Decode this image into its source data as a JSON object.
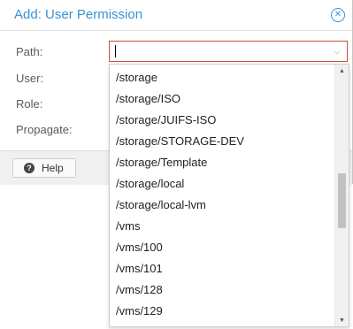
{
  "dialog": {
    "title": "Add: User Permission",
    "close_icon": "close-circle-icon"
  },
  "form": {
    "path_label": "Path:",
    "user_label": "User:",
    "role_label": "Role:",
    "propagate_label": "Propagate:",
    "path_value": ""
  },
  "footer": {
    "help_label": "Help",
    "help_icon": "question-circle-icon"
  },
  "dropdown": {
    "options": [
      "/storage",
      "/storage/ISO",
      "/storage/JUIFS-ISO",
      "/storage/STORAGE-DEV",
      "/storage/Template",
      "/storage/local",
      "/storage/local-lvm",
      "/vms",
      "/vms/100",
      "/vms/101",
      "/vms/128",
      "/vms/129"
    ]
  },
  "colors": {
    "accent": "#3892d4",
    "invalid_border": "#cf4c35"
  }
}
